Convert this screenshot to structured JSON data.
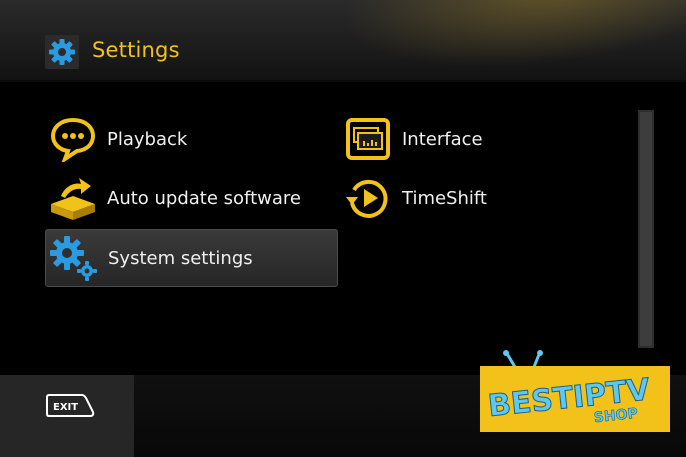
{
  "header": {
    "title": "Settings",
    "icon": "gear-icon"
  },
  "menu": {
    "items": [
      {
        "label": "Playback",
        "icon": "speech-bubble-icon"
      },
      {
        "label": "Interface",
        "icon": "interface-screen-icon"
      },
      {
        "label": "Auto update software",
        "icon": "update-box-icon"
      },
      {
        "label": "TimeShift",
        "icon": "timeshift-play-icon"
      },
      {
        "label": "System settings",
        "icon": "system-gears-icon",
        "selected": true
      }
    ]
  },
  "footer": {
    "exit_label": "EXIT"
  },
  "branding": {
    "logo_line1": "BESTIPTV",
    "logo_line2": "SHOP"
  },
  "colors": {
    "accent": "#f2c21b",
    "logo_bg": "#f2c21b",
    "logo_text": "#5ec8f0"
  }
}
